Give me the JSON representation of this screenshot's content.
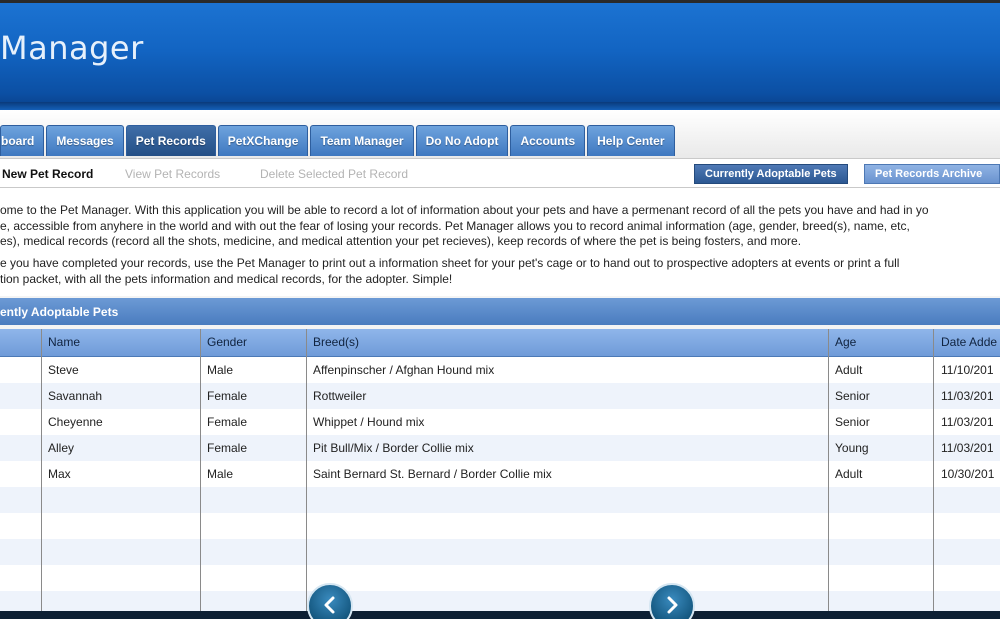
{
  "header": {
    "title": "Manager"
  },
  "tabs": [
    {
      "label": "board",
      "active": false
    },
    {
      "label": "Messages",
      "active": false
    },
    {
      "label": "Pet Records",
      "active": true
    },
    {
      "label": "PetXChange",
      "active": false
    },
    {
      "label": "Team Manager",
      "active": false
    },
    {
      "label": "Do No Adopt",
      "active": false
    },
    {
      "label": "Accounts",
      "active": false
    },
    {
      "label": "Help Center",
      "active": false
    }
  ],
  "toolbar": {
    "new_record": "New Pet Record",
    "view_records": "View Pet Records",
    "delete_selected": "Delete Selected Pet Record",
    "view_current": "Currently Adoptable Pets",
    "view_archive": "Pet Records Archive"
  },
  "intro": {
    "line1": "ome to the Pet Manager. With this application you will be able to record a lot of information about your pets and have a permenant record of all the pets you have and had in yo",
    "line2": "e, accessible from anyhere in the world and with out the fear of losing your records. Pet Manager allows you to record animal information (age, gender, breed(s), name, etc,",
    "line3": "es), medical records (record all the shots, medicine, and medical attention your pet recieves), keep records of where the pet is being fosters, and more.",
    "line4": "e you have completed your records, use the Pet Manager to print out a information sheet for your pet's cage or to hand out to prospective adopters at events or print a full",
    "line5": "tion packet, with all the pets information and medical records, for the adopter. Simple!"
  },
  "table": {
    "title": "ently Adoptable Pets",
    "headers": {
      "name": "Name",
      "gender": "Gender",
      "breed": "Breed(s)",
      "age": "Age",
      "date": "Date Adde"
    },
    "rows": [
      {
        "name": "Steve",
        "gender": "Male",
        "breed": "Affenpinscher  / Afghan Hound  mix",
        "age": "Adult",
        "date": "11/10/201"
      },
      {
        "name": "Savannah",
        "gender": "Female",
        "breed": "Rottweiler",
        "age": "Senior",
        "date": "11/03/201"
      },
      {
        "name": "Cheyenne",
        "gender": "Female",
        "breed": "Whippet  / Hound  mix",
        "age": "Senior",
        "date": "11/03/201"
      },
      {
        "name": "Alley",
        "gender": "Female",
        "breed": "Pit Bull/Mix  / Border Collie  mix",
        "age": "Young",
        "date": "11/03/201"
      },
      {
        "name": "Max",
        "gender": "Male",
        "breed": "Saint Bernard St. Bernard  / Border Collie  mix",
        "age": "Adult",
        "date": "10/30/201"
      }
    ]
  },
  "icons": {
    "prev": "chevron-left-icon",
    "next": "chevron-right-icon"
  },
  "colors": {
    "header_blue": "#1264c2",
    "tab_blue": "#3f78c0",
    "row_alt": "#eef3fb"
  }
}
